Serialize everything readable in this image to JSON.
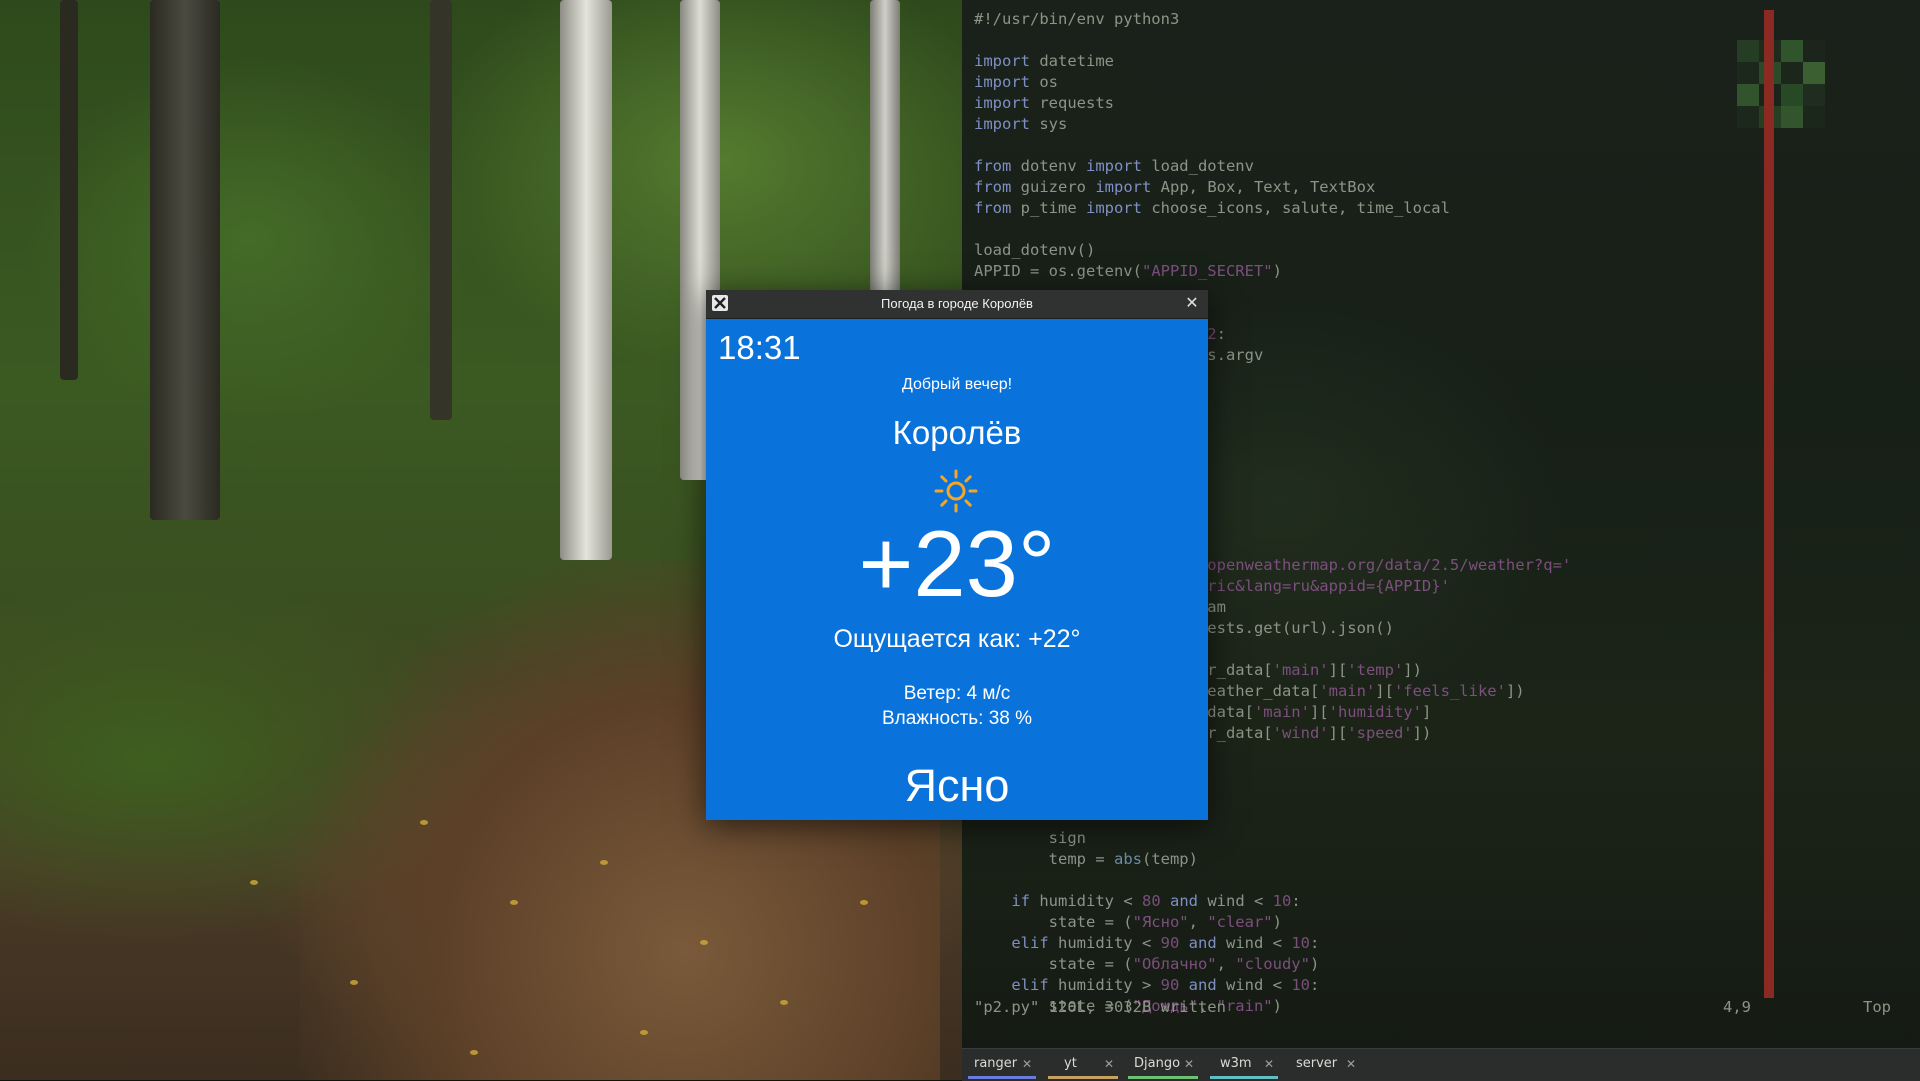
{
  "weather_window": {
    "title": "Погода в городе Королёв",
    "close_icon": "close-icon",
    "app_icon": "x-window-icon",
    "time": "18:31",
    "greeting": "Добрый вечер!",
    "city": "Королёв",
    "weather_icon": "sun-icon",
    "temperature": "+23°",
    "feels_like": "Ощущается как: +22°",
    "wind": "Ветер: 4 м/с",
    "humidity": "Влажность: 38 %",
    "condition": "Ясно",
    "background_color": "#0a73db",
    "icon_color": "#f5a623"
  },
  "editor": {
    "status_message": "\"p2.py\" 120L, 3032B written",
    "cursor_position": "4,9",
    "scroll_position": "Top"
  },
  "tabs": [
    {
      "label": "ranger",
      "color": "#6a7be0"
    },
    {
      "label": "yt",
      "color": "#c8a060"
    },
    {
      "label": "Django",
      "color": "#6cc070"
    },
    {
      "label": "w3m",
      "color": "#60c0c0"
    },
    {
      "label": "server",
      "color": "#909090"
    }
  ]
}
